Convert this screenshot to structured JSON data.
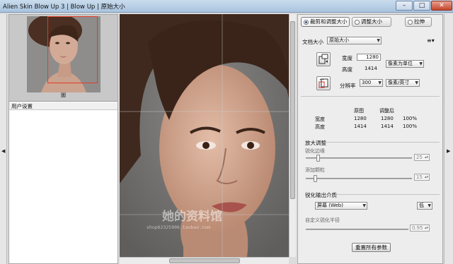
{
  "window": {
    "title": "Alien Skin Blow Up 3 | Blow Up | 原始大小",
    "minimize_glyph": "–",
    "maximize_glyph": "□",
    "close_glyph": "✕"
  },
  "side_arrows": {
    "left": "◀",
    "right": "▶"
  },
  "navigator": {
    "label": "圖"
  },
  "left_section": {
    "title": "用户设置"
  },
  "watermark": {
    "main": "她的资料馆",
    "sub": "shop62325906.taobao.com"
  },
  "tabs": [
    {
      "label": "裁剪和调整大小",
      "selected": true
    },
    {
      "label": "调整大小",
      "selected": false
    },
    {
      "label": "拉伸",
      "selected": false
    }
  ],
  "document_size": {
    "label": "文档大小",
    "value": "原始大小",
    "menu_glyph": "≡▾"
  },
  "dimensions": {
    "width_label": "宽度",
    "width_value": "1280",
    "height_label": "高度",
    "height_value": "1414",
    "unit": "像素为单位",
    "resolution_label": "分辨率",
    "resolution_value": "300",
    "resolution_unit": "像素/英寸"
  },
  "size_table": {
    "headers": [
      "原图",
      "调整后"
    ],
    "rows": [
      {
        "label": "宽度",
        "original": "1280",
        "adjusted": "1280",
        "percent": "100%"
      },
      {
        "label": "高度",
        "original": "1414",
        "adjusted": "1414",
        "percent": "100%"
      }
    ]
  },
  "enlarge": {
    "title": "放大调整",
    "sharpen_label": "锐化边缘",
    "sharpen_value": "25",
    "sharpen_level": 0.1,
    "grain_label": "添加颗粒",
    "grain_value": "15",
    "grain_level": 0.07
  },
  "output": {
    "title": "锐化输出介质",
    "medium": "屏幕 (Web)",
    "level": "低",
    "radius_label": "自定义锐化半径",
    "radius_value": "0.95"
  },
  "reset_button": "重置所有参数",
  "colors": {
    "accent_red": "#e23a2a",
    "close_red": "#c4452c",
    "titlebar": "#b6cde3"
  }
}
